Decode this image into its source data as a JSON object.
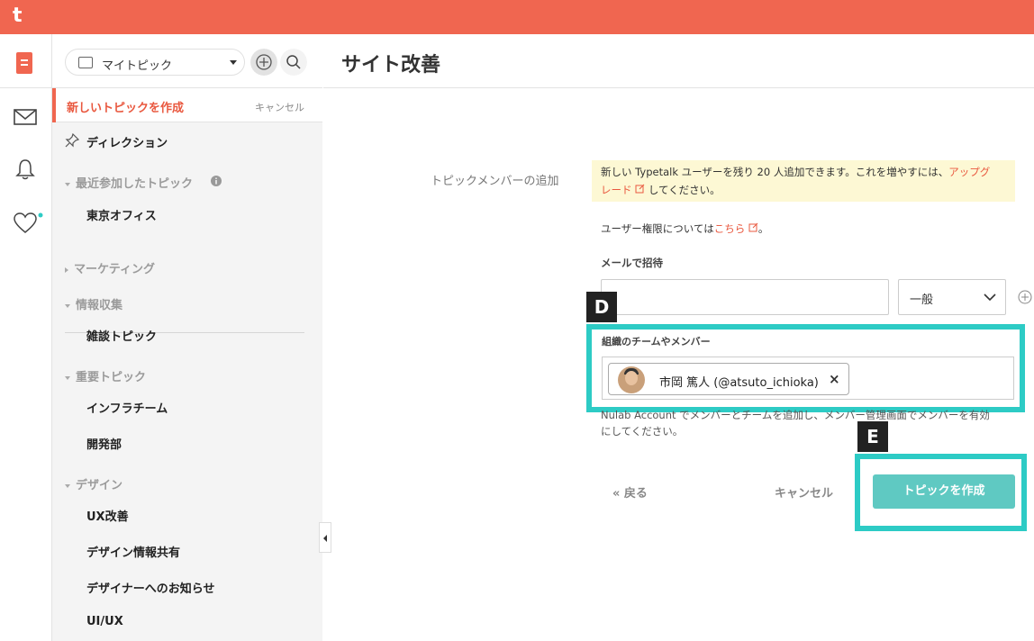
{
  "app": {
    "logo_letter": "t"
  },
  "sidebar": {
    "topic_selector": "マイトピック",
    "new_topic_label": "新しいトピックを作成",
    "new_topic_cancel": "キャンセル",
    "pinned": "ディレクション",
    "groups": [
      {
        "label": "最近参加したトピック",
        "expanded": true,
        "items": [
          "東京オフィス"
        ]
      },
      {
        "label": "マーケティング",
        "expanded": false,
        "items": []
      },
      {
        "label": "情報収集",
        "expanded": true,
        "items": [
          "雑談トピック"
        ]
      },
      {
        "label": "重要トピック",
        "expanded": true,
        "items": [
          "インフラチーム",
          "開発部"
        ]
      },
      {
        "label": "デザイン",
        "expanded": true,
        "items": [
          "UX改善",
          "デザイン情報共有",
          "デザイナーへのお知らせ",
          "UI/UX"
        ]
      }
    ]
  },
  "main": {
    "title": "サイト改善",
    "member_section_label": "トピックメンバーの追加",
    "notice": {
      "text1": "新しい Typetalk ユーザーを残り 20 人追加できます。これを増やすには、",
      "link1": "アップグ",
      "link2": "レード",
      "text2": "してください。"
    },
    "permission": {
      "text1": "ユーザー権限については",
      "link": "こちら",
      "text2": "。"
    },
    "email_label": "メールで招待",
    "email_value": "",
    "role_value": "一般",
    "org_label": "組織のチームやメンバー",
    "member_chip": "市岡 篤人 (@atsuto_ichioka)",
    "footer_note": {
      "t1": "Nulab Account でメンバーとチームを追加",
      "t2": "し、メンバー管理画面でメンバーを有効",
      "t3": "にしてください。"
    },
    "back_label": "« 戻る",
    "cancel_label": "キャンセル",
    "create_label": "トピックを作成"
  },
  "annotations": {
    "d": "D",
    "e": "E"
  },
  "colors": {
    "brand": "#f06650",
    "accent": "#5fc9c2",
    "highlight": "#2dcbc5"
  }
}
